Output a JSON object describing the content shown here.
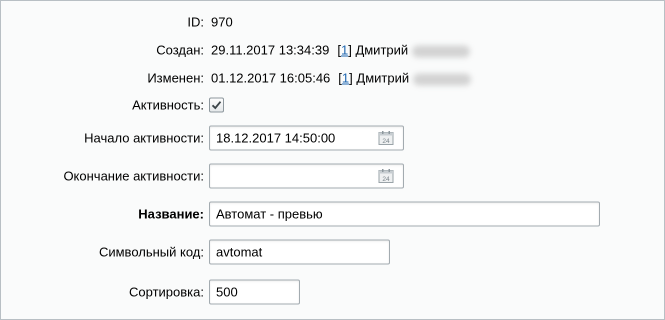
{
  "fields": {
    "id": {
      "label": "ID:",
      "value": "970"
    },
    "created": {
      "label": "Создан:",
      "date": "29.11.2017 13:34:39",
      "user_id": "1",
      "user_name": "Дмитрий"
    },
    "modified": {
      "label": "Изменен:",
      "date": "01.12.2017 16:05:46",
      "user_id": "1",
      "user_name": "Дмитрий"
    },
    "active": {
      "label": "Активность:",
      "checked": true
    },
    "active_from": {
      "label": "Начало активности:",
      "value": "18.12.2017 14:50:00"
    },
    "active_to": {
      "label": "Окончание активности:",
      "value": ""
    },
    "name": {
      "label": "Название:",
      "value": "Автомат - превью"
    },
    "code": {
      "label": "Символьный код:",
      "value": "avtomat"
    },
    "sort": {
      "label": "Сортировка:",
      "value": "500"
    }
  },
  "icons": {
    "checkbox": "check-icon",
    "calendar": "calendar-icon"
  },
  "colors": {
    "link": "#2067b0",
    "border": "#a3abb0",
    "background": "#fafbfb"
  }
}
